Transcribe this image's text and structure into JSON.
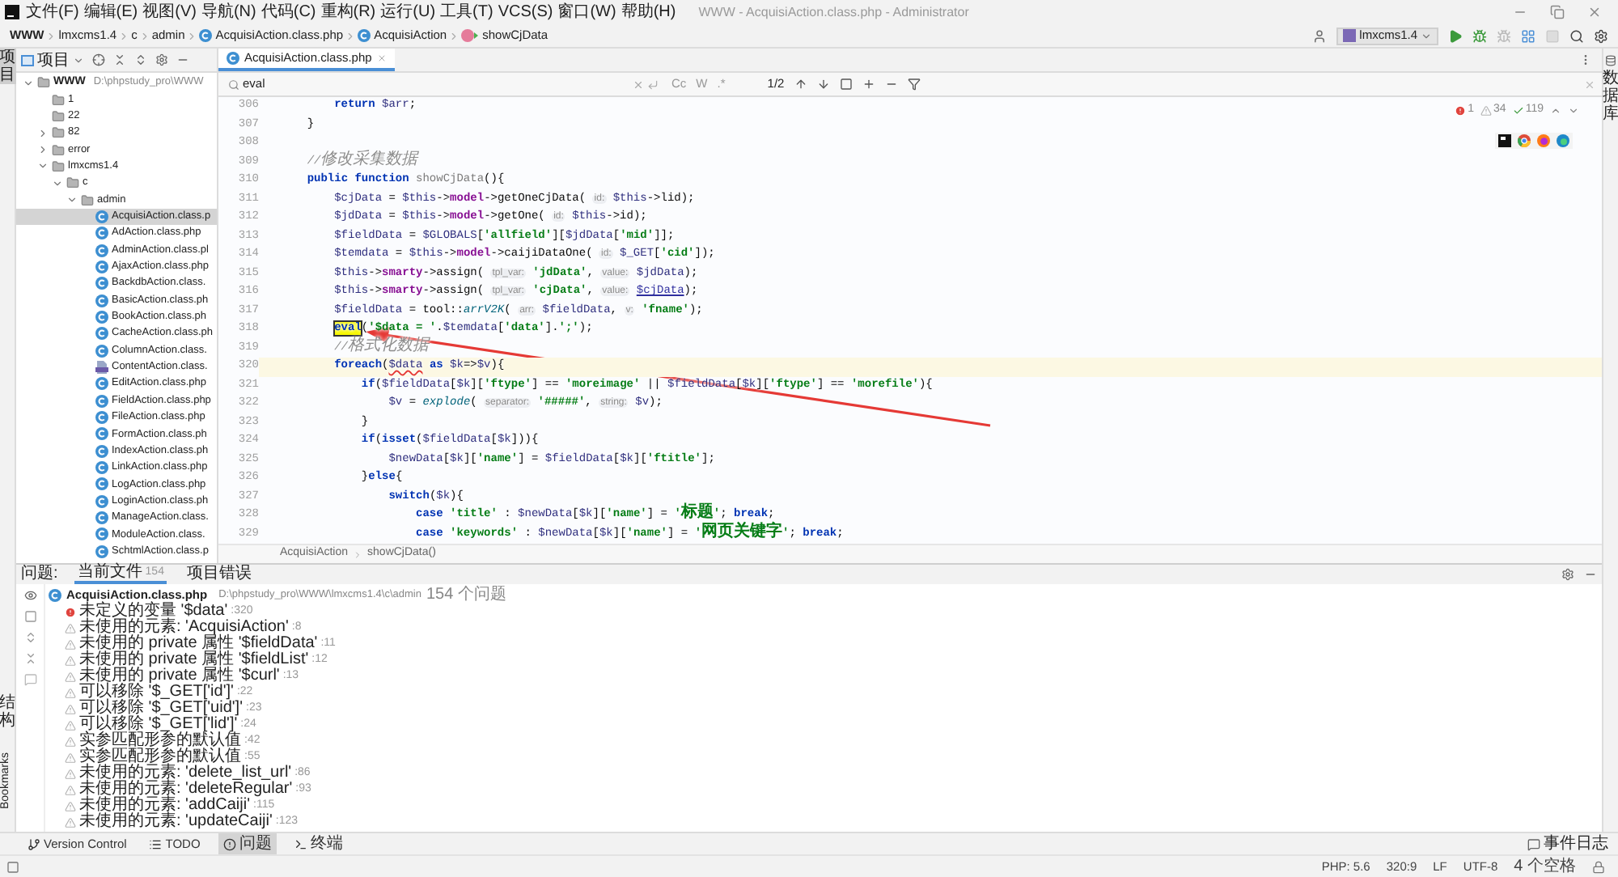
{
  "menu_bar": {
    "items": [
      "文件(F)",
      "编辑(E)",
      "视图(V)",
      "导航(N)",
      "代码(C)",
      "重构(R)",
      "运行(U)",
      "工具(T)",
      "VCS(S)",
      "窗口(W)",
      "帮助(H)"
    ],
    "title": "WWW - AcquisiAction.class.php - Administrator"
  },
  "nav_bar": {
    "path": [
      {
        "label": "WWW",
        "kind": "project"
      },
      {
        "label": "lmxcms1.4",
        "kind": "folder"
      },
      {
        "label": "c",
        "kind": "folder"
      },
      {
        "label": "admin",
        "kind": "folder"
      },
      {
        "label": "AcquisiAction.class.php",
        "kind": "class"
      },
      {
        "label": "AcquisiAction",
        "kind": "class"
      },
      {
        "label": "showCjData",
        "kind": "method"
      }
    ],
    "run_config": "lmxcms1.4"
  },
  "side_labels": {
    "left_top": "项目",
    "left_bottom": [
      "结构",
      "Bookmarks"
    ],
    "right": "数据库"
  },
  "project_panel": {
    "title": "项目",
    "tree": [
      {
        "label": "WWW",
        "detail": "D:\\phpstudy_pro\\WWW",
        "kind": "folder",
        "expanded": true,
        "selected": false,
        "children": [
          {
            "label": "1",
            "kind": "folder",
            "selected": false
          },
          {
            "label": "22",
            "kind": "folder",
            "selected": false
          },
          {
            "label": "82",
            "kind": "folder",
            "expanded": false,
            "selected": false
          },
          {
            "label": "error",
            "kind": "folder",
            "expanded": false,
            "selected": false
          },
          {
            "label": "lmxcms1.4",
            "kind": "folder",
            "expanded": true,
            "selected": false,
            "children": [
              {
                "label": "c",
                "kind": "folder",
                "expanded": true,
                "selected": false,
                "children": [
                  {
                    "label": "admin",
                    "kind": "folder",
                    "expanded": true,
                    "selected": false,
                    "children": [
                      {
                        "label": "AcquisiAction.class.p",
                        "kind": "class",
                        "selected": true
                      },
                      {
                        "label": "AdAction.class.php",
                        "kind": "class",
                        "selected": false
                      },
                      {
                        "label": "AdminAction.class.pl",
                        "kind": "class",
                        "selected": false
                      },
                      {
                        "label": "AjaxAction.class.php",
                        "kind": "class",
                        "selected": false
                      },
                      {
                        "label": "BackdbAction.class.",
                        "kind": "class",
                        "selected": false
                      },
                      {
                        "label": "BasicAction.class.ph",
                        "kind": "class",
                        "selected": false
                      },
                      {
                        "label": "BookAction.class.ph",
                        "kind": "class",
                        "selected": false
                      },
                      {
                        "label": "CacheAction.class.ph",
                        "kind": "class",
                        "selected": false
                      },
                      {
                        "label": "ColumnAction.class.",
                        "kind": "class",
                        "selected": false
                      },
                      {
                        "label": "ContentAction.class.",
                        "kind": "php",
                        "selected": false
                      },
                      {
                        "label": "EditAction.class.php",
                        "kind": "class",
                        "selected": false
                      },
                      {
                        "label": "FieldAction.class.php",
                        "kind": "class",
                        "selected": false
                      },
                      {
                        "label": "FileAction.class.php",
                        "kind": "class",
                        "selected": false
                      },
                      {
                        "label": "FormAction.class.ph",
                        "kind": "class",
                        "selected": false
                      },
                      {
                        "label": "IndexAction.class.ph",
                        "kind": "class",
                        "selected": false
                      },
                      {
                        "label": "LinkAction.class.php",
                        "kind": "class",
                        "selected": false
                      },
                      {
                        "label": "LogAction.class.php",
                        "kind": "class",
                        "selected": false
                      },
                      {
                        "label": "LoginAction.class.ph",
                        "kind": "class",
                        "selected": false
                      },
                      {
                        "label": "ManageAction.class.",
                        "kind": "class",
                        "selected": false
                      },
                      {
                        "label": "ModuleAction.class.",
                        "kind": "class",
                        "selected": false
                      },
                      {
                        "label": "SchtmlAction.class.p",
                        "kind": "class",
                        "selected": false
                      }
                    ]
                  }
                ]
              }
            ]
          }
        ]
      }
    ]
  },
  "editor": {
    "tabs": [
      {
        "label": "AcquisiAction.class.php",
        "selected": true
      }
    ],
    "search": {
      "value": "eval",
      "options": [
        "Cc",
        "W",
        ".*"
      ],
      "count": "1/2"
    },
    "inspections": {
      "errors": "1",
      "warnings": "34",
      "checks": "119"
    },
    "lines": [
      {
        "number": "306",
        "current": false,
        "tokens": [
          {
            "kind": "keyword",
            "text": "        return"
          },
          {
            "kind": "variable",
            "text": " $arr"
          },
          {
            "kind": "plain",
            "text": ";"
          }
        ]
      },
      {
        "number": "307",
        "current": false,
        "tokens": [
          {
            "kind": "plain",
            "text": "    }"
          }
        ]
      },
      {
        "number": "308",
        "current": false
      },
      {
        "number": "309",
        "current": false,
        "tokens": [
          {
            "kind": "comment",
            "text": "    //修改采集数据"
          }
        ]
      },
      {
        "number": "310",
        "current": false,
        "tokens": [
          {
            "kind": "keyword",
            "text": "    public function"
          },
          {
            "kind": "declaration",
            "text": " showCjData"
          },
          {
            "kind": "plain",
            "text": "(){"
          }
        ]
      },
      {
        "number": "311",
        "current": false,
        "tokens": [
          {
            "kind": "variable",
            "text": "        $cjData"
          },
          {
            "kind": "plain",
            "text": " = "
          },
          {
            "kind": "variable",
            "text": "$this"
          },
          {
            "kind": "plain",
            "text": "->"
          },
          {
            "kind": "member",
            "text": "model"
          },
          {
            "kind": "plain",
            "text": "->getOneCjData( "
          },
          {
            "kind": "hint",
            "text": "id:"
          },
          {
            "kind": "variable",
            "text": " $this"
          },
          {
            "kind": "plain",
            "text": "->lid);"
          }
        ]
      },
      {
        "number": "312",
        "current": false,
        "tokens": [
          {
            "kind": "variable",
            "text": "        $jdData"
          },
          {
            "kind": "plain",
            "text": " = "
          },
          {
            "kind": "variable",
            "text": "$this"
          },
          {
            "kind": "plain",
            "text": "->"
          },
          {
            "kind": "member",
            "text": "model"
          },
          {
            "kind": "plain",
            "text": "->getOne( "
          },
          {
            "kind": "hint",
            "text": "id:"
          },
          {
            "kind": "variable",
            "text": " $this"
          },
          {
            "kind": "plain",
            "text": "->id);"
          }
        ]
      },
      {
        "number": "313",
        "current": false,
        "tokens": [
          {
            "kind": "variable",
            "text": "        $fieldData"
          },
          {
            "kind": "plain",
            "text": " = "
          },
          {
            "kind": "variable",
            "text": "$GLOBALS"
          },
          {
            "kind": "plain",
            "text": "["
          },
          {
            "kind": "string",
            "text": "'allfield'"
          },
          {
            "kind": "plain",
            "text": "]["
          },
          {
            "kind": "variable",
            "text": "$jdData"
          },
          {
            "kind": "plain",
            "text": "["
          },
          {
            "kind": "string",
            "text": "'mid'"
          },
          {
            "kind": "plain",
            "text": "]];"
          }
        ]
      },
      {
        "number": "314",
        "current": false,
        "tokens": [
          {
            "kind": "variable",
            "text": "        $temdata"
          },
          {
            "kind": "plain",
            "text": " = "
          },
          {
            "kind": "variable",
            "text": "$this"
          },
          {
            "kind": "plain",
            "text": "->"
          },
          {
            "kind": "member",
            "text": "model"
          },
          {
            "kind": "plain",
            "text": "->caijiDataOne( "
          },
          {
            "kind": "hint",
            "text": "id:"
          },
          {
            "kind": "variable",
            "text": " $_GET"
          },
          {
            "kind": "plain",
            "text": "["
          },
          {
            "kind": "string",
            "text": "'cid'"
          },
          {
            "kind": "plain",
            "text": "]);"
          }
        ]
      },
      {
        "number": "315",
        "current": false,
        "tokens": [
          {
            "kind": "variable",
            "text": "        $this"
          },
          {
            "kind": "plain",
            "text": "->"
          },
          {
            "kind": "member",
            "text": "smarty"
          },
          {
            "kind": "plain",
            "text": "->assign( "
          },
          {
            "kind": "hint",
            "text": "tpl_var:"
          },
          {
            "kind": "string",
            "text": " 'jdData'"
          },
          {
            "kind": "plain",
            "text": ", "
          },
          {
            "kind": "hint",
            "text": "value:"
          },
          {
            "kind": "variable",
            "text": " $jdData"
          },
          {
            "kind": "plain",
            "text": ");"
          }
        ]
      },
      {
        "number": "316",
        "current": false,
        "tokens": [
          {
            "kind": "variable",
            "text": "        $this"
          },
          {
            "kind": "plain",
            "text": "->"
          },
          {
            "kind": "member",
            "text": "smarty"
          },
          {
            "kind": "plain",
            "text": "->assign( "
          },
          {
            "kind": "hint",
            "text": "tpl_var:"
          },
          {
            "kind": "string",
            "text": " 'cjData'"
          },
          {
            "kind": "plain",
            "text": ", "
          },
          {
            "kind": "hint",
            "text": "value:"
          },
          {
            "kind": "link",
            "text": " $cjData"
          },
          {
            "kind": "plain",
            "text": ");"
          }
        ]
      },
      {
        "number": "317",
        "current": false,
        "tokens": [
          {
            "kind": "variable",
            "text": "        $fieldData"
          },
          {
            "kind": "plain",
            "text": " = tool::"
          },
          {
            "kind": "function",
            "text": "arrV2K"
          },
          {
            "kind": "plain",
            "text": "( "
          },
          {
            "kind": "hint",
            "text": "arr:"
          },
          {
            "kind": "variable",
            "text": " $fieldData"
          },
          {
            "kind": "plain",
            "text": ", "
          },
          {
            "kind": "hint",
            "text": "v:"
          },
          {
            "kind": "string",
            "text": " 'fname'"
          },
          {
            "kind": "plain",
            "text": ");"
          }
        ]
      },
      {
        "number": "318",
        "current": false,
        "tokens": [
          {
            "kind": "match",
            "text": "        eval"
          },
          {
            "kind": "plain",
            "text": "("
          },
          {
            "kind": "string",
            "text": "'$data = '"
          },
          {
            "kind": "plain",
            "text": "."
          },
          {
            "kind": "variable",
            "text": "$temdata"
          },
          {
            "kind": "plain",
            "text": "["
          },
          {
            "kind": "string",
            "text": "'data'"
          },
          {
            "kind": "plain",
            "text": "]."
          },
          {
            "kind": "string",
            "text": "';'"
          },
          {
            "kind": "plain",
            "text": ");"
          }
        ]
      },
      {
        "number": "319",
        "current": false,
        "tokens": [
          {
            "kind": "comment",
            "text": "        //格式化数据"
          }
        ]
      },
      {
        "number": "320",
        "current": true,
        "tokens": [
          {
            "kind": "keyword",
            "text": "        foreach"
          },
          {
            "kind": "plain",
            "text": "("
          },
          {
            "kind": "undefined",
            "text": "$data"
          },
          {
            "kind": "keyword",
            "text": " as"
          },
          {
            "kind": "variable",
            "text": " $k"
          },
          {
            "kind": "plain",
            "text": "=>"
          },
          {
            "kind": "variable",
            "text": "$v"
          },
          {
            "kind": "plain",
            "text": "){"
          }
        ]
      },
      {
        "number": "321",
        "current": false,
        "tokens": [
          {
            "kind": "keyword",
            "text": "            if"
          },
          {
            "kind": "plain",
            "text": "("
          },
          {
            "kind": "variable",
            "text": "$fieldData"
          },
          {
            "kind": "plain",
            "text": "["
          },
          {
            "kind": "variable",
            "text": "$k"
          },
          {
            "kind": "plain",
            "text": "]["
          },
          {
            "kind": "string",
            "text": "'ftype'"
          },
          {
            "kind": "plain",
            "text": "] == "
          },
          {
            "kind": "string",
            "text": "'moreimage'"
          },
          {
            "kind": "plain",
            "text": " || "
          },
          {
            "kind": "variable",
            "text": "$fieldData"
          },
          {
            "kind": "plain",
            "text": "["
          },
          {
            "kind": "variable",
            "text": "$k"
          },
          {
            "kind": "plain",
            "text": "]["
          },
          {
            "kind": "string",
            "text": "'ftype'"
          },
          {
            "kind": "plain",
            "text": "] == "
          },
          {
            "kind": "string",
            "text": "'morefile'"
          },
          {
            "kind": "plain",
            "text": "){"
          }
        ]
      },
      {
        "number": "322",
        "current": false,
        "tokens": [
          {
            "kind": "variable",
            "text": "                $v"
          },
          {
            "kind": "plain",
            "text": " = "
          },
          {
            "kind": "function",
            "text": "explode"
          },
          {
            "kind": "plain",
            "text": "( "
          },
          {
            "kind": "hint",
            "text": "separator:"
          },
          {
            "kind": "string",
            "text": " '#####'"
          },
          {
            "kind": "plain",
            "text": ", "
          },
          {
            "kind": "hint",
            "text": "string:"
          },
          {
            "kind": "variable",
            "text": " $v"
          },
          {
            "kind": "plain",
            "text": ");"
          }
        ]
      },
      {
        "number": "323",
        "current": false,
        "tokens": [
          {
            "kind": "plain",
            "text": "            }"
          }
        ]
      },
      {
        "number": "324",
        "current": false,
        "tokens": [
          {
            "kind": "keyword",
            "text": "            if"
          },
          {
            "kind": "plain",
            "text": "("
          },
          {
            "kind": "keyword",
            "text": "isset"
          },
          {
            "kind": "plain",
            "text": "("
          },
          {
            "kind": "variable",
            "text": "$fieldData"
          },
          {
            "kind": "plain",
            "text": "["
          },
          {
            "kind": "variable",
            "text": "$k"
          },
          {
            "kind": "plain",
            "text": "])){"
          }
        ]
      },
      {
        "number": "325",
        "current": false,
        "tokens": [
          {
            "kind": "variable",
            "text": "                $newData"
          },
          {
            "kind": "plain",
            "text": "["
          },
          {
            "kind": "variable",
            "text": "$k"
          },
          {
            "kind": "plain",
            "text": "]["
          },
          {
            "kind": "string",
            "text": "'name'"
          },
          {
            "kind": "plain",
            "text": "] = "
          },
          {
            "kind": "variable",
            "text": "$fieldData"
          },
          {
            "kind": "plain",
            "text": "["
          },
          {
            "kind": "variable",
            "text": "$k"
          },
          {
            "kind": "plain",
            "text": "]["
          },
          {
            "kind": "string",
            "text": "'ftitle'"
          },
          {
            "kind": "plain",
            "text": "];"
          }
        ]
      },
      {
        "number": "326",
        "current": false,
        "tokens": [
          {
            "kind": "plain",
            "text": "            }"
          },
          {
            "kind": "keyword",
            "text": "else"
          },
          {
            "kind": "plain",
            "text": "{"
          }
        ]
      },
      {
        "number": "327",
        "current": false,
        "tokens": [
          {
            "kind": "keyword",
            "text": "                switch"
          },
          {
            "kind": "plain",
            "text": "("
          },
          {
            "kind": "variable",
            "text": "$k"
          },
          {
            "kind": "plain",
            "text": "){"
          }
        ]
      },
      {
        "number": "328",
        "current": false,
        "tokens": [
          {
            "kind": "keyword",
            "text": "                    case"
          },
          {
            "kind": "string",
            "text": " 'title'"
          },
          {
            "kind": "plain",
            "text": " : "
          },
          {
            "kind": "variable",
            "text": "$newData"
          },
          {
            "kind": "plain",
            "text": "["
          },
          {
            "kind": "variable",
            "text": "$k"
          },
          {
            "kind": "plain",
            "text": "]["
          },
          {
            "kind": "string",
            "text": "'name'"
          },
          {
            "kind": "plain",
            "text": "] = "
          },
          {
            "kind": "string",
            "text": "'标题'"
          },
          {
            "kind": "plain",
            "text": "; "
          },
          {
            "kind": "keyword",
            "text": "break"
          },
          {
            "kind": "plain",
            "text": ";"
          }
        ]
      },
      {
        "number": "329",
        "current": false,
        "tokens": [
          {
            "kind": "keyword",
            "text": "                    case"
          },
          {
            "kind": "string",
            "text": " 'keywords'"
          },
          {
            "kind": "plain",
            "text": " : "
          },
          {
            "kind": "variable",
            "text": "$newData"
          },
          {
            "kind": "plain",
            "text": "["
          },
          {
            "kind": "variable",
            "text": "$k"
          },
          {
            "kind": "plain",
            "text": "]["
          },
          {
            "kind": "string",
            "text": "'name'"
          },
          {
            "kind": "plain",
            "text": "] = "
          },
          {
            "kind": "string",
            "text": "'网页关键字'"
          },
          {
            "kind": "plain",
            "text": "; "
          },
          {
            "kind": "keyword",
            "text": "break"
          },
          {
            "kind": "plain",
            "text": ";"
          }
        ]
      }
    ],
    "breadcrumb": [
      "AcquisiAction",
      "showCjData()"
    ]
  },
  "problems": {
    "title": "问题:",
    "tabs": [
      {
        "label": "当前文件",
        "count": "154",
        "selected": true
      },
      {
        "label": "项目错误",
        "selected": false
      }
    ],
    "file": {
      "name": "AcquisiAction.class.php",
      "path": "D:\\phpstudy_pro\\WWW\\lmxcms1.4\\c\\admin",
      "count": "154 个问题"
    },
    "items": [
      {
        "kind": "error",
        "text": "未定义的变量 '$data'",
        "line": ":320"
      },
      {
        "kind": "warning",
        "text": "未使用的元素: 'AcquisiAction'",
        "line": ":8"
      },
      {
        "kind": "warning",
        "text": "未使用的 private 属性 '$fieldData'",
        "line": ":11"
      },
      {
        "kind": "warning",
        "text": "未使用的 private 属性 '$fieldList'",
        "line": ":12"
      },
      {
        "kind": "warning",
        "text": "未使用的 private 属性 '$curl'",
        "line": ":13"
      },
      {
        "kind": "warning",
        "text": "可以移除 '$_GET['id']'",
        "line": ":22"
      },
      {
        "kind": "warning",
        "text": "可以移除 '$_GET['uid']'",
        "line": ":23"
      },
      {
        "kind": "warning",
        "text": "可以移除 '$_GET['lid']'",
        "line": ":24"
      },
      {
        "kind": "warning",
        "text": "实参匹配形参的默认值",
        "line": ":42"
      },
      {
        "kind": "warning",
        "text": "实参匹配形参的默认值",
        "line": ":55"
      },
      {
        "kind": "warning",
        "text": "未使用的元素: 'delete_list_url'",
        "line": ":86"
      },
      {
        "kind": "warning",
        "text": "未使用的元素: 'deleteRegular'",
        "line": ":93"
      },
      {
        "kind": "warning",
        "text": "未使用的元素: 'addCaiji'",
        "line": ":115"
      },
      {
        "kind": "warning",
        "text": "未使用的元素: 'updateCaiji'",
        "line": ":123"
      }
    ]
  },
  "bottom_bar": {
    "tools": [
      {
        "label": "Version Control",
        "kind": "vcs",
        "selected": false
      },
      {
        "label": "TODO",
        "kind": "todo",
        "selected": false
      },
      {
        "label": "问题",
        "kind": "problems",
        "selected": true
      },
      {
        "label": "终端",
        "kind": "terminal",
        "selected": false
      }
    ],
    "event_log": "事件日志"
  },
  "status_bar": {
    "items": [
      "PHP: 5.6",
      "320:9",
      "LF",
      "UTF-8",
      "4 个空格"
    ]
  }
}
